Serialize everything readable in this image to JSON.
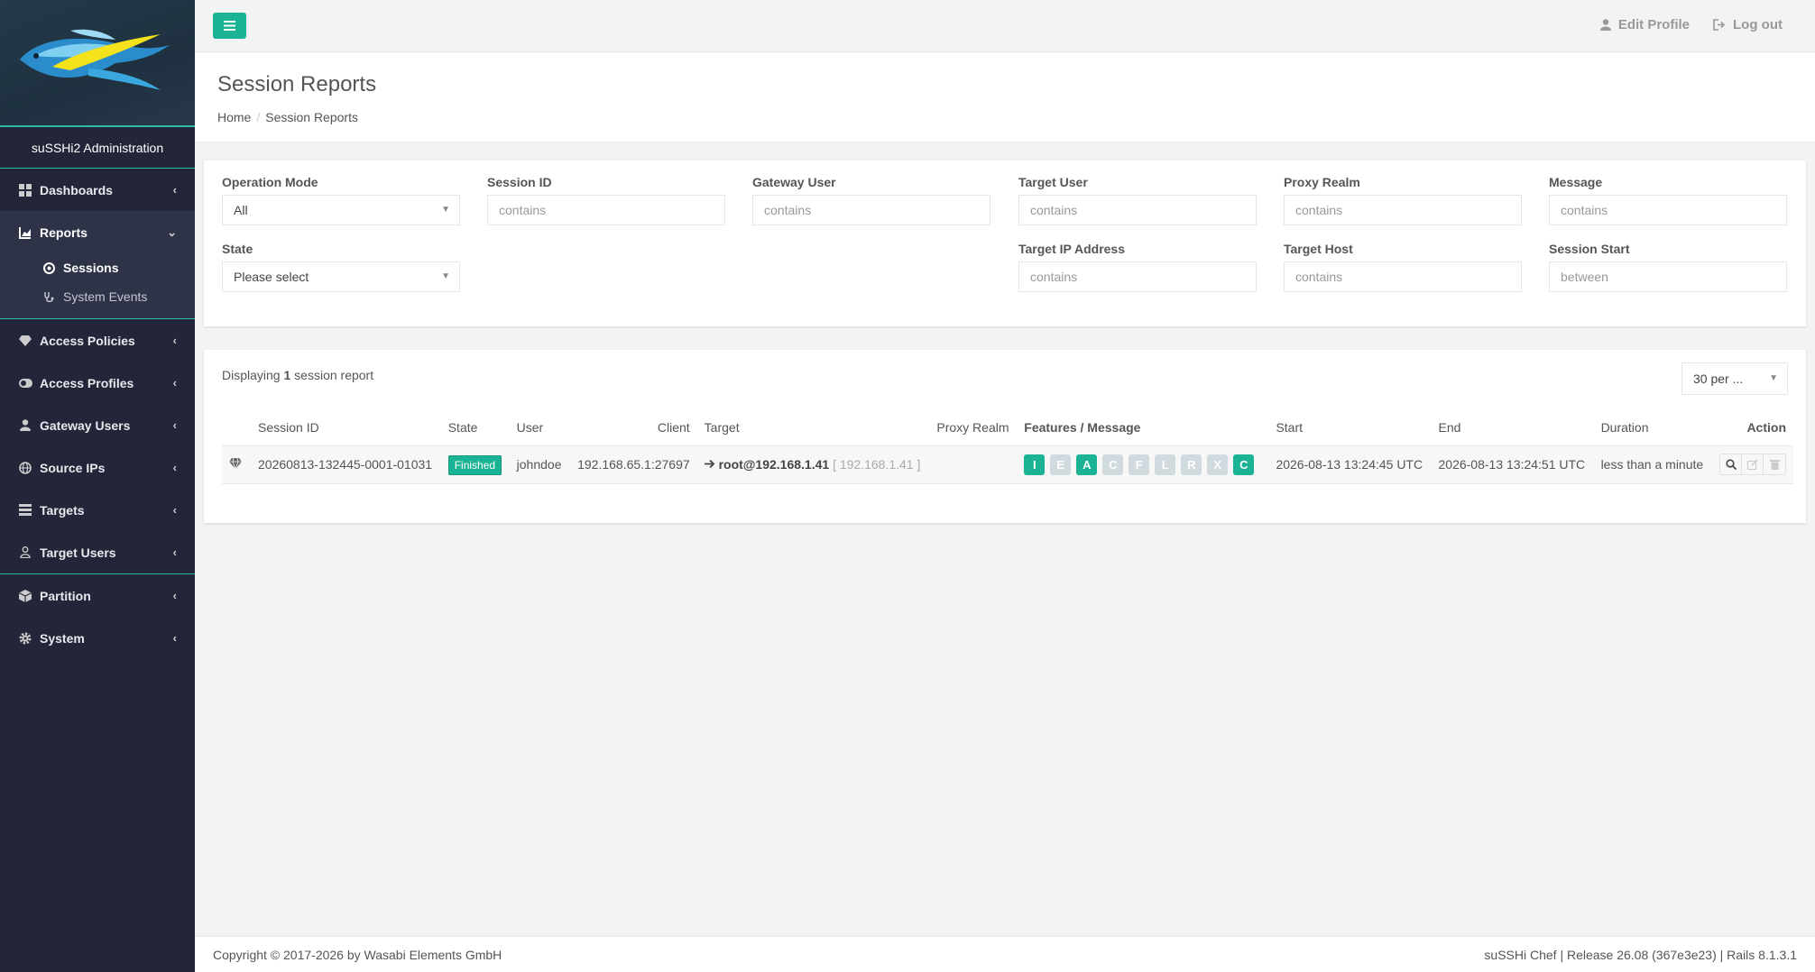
{
  "app": {
    "name": "suSSHi2 Administration"
  },
  "sidebar": {
    "items": [
      {
        "label": "Dashboards",
        "icon": "dashboard-icon"
      },
      {
        "label": "Reports",
        "icon": "chart-icon"
      },
      {
        "label": "Access Policies",
        "icon": "diamond-icon"
      },
      {
        "label": "Access Profiles",
        "icon": "toggle-icon"
      },
      {
        "label": "Gateway Users",
        "icon": "user-icon"
      },
      {
        "label": "Source IPs",
        "icon": "globe-icon"
      },
      {
        "label": "Targets",
        "icon": "server-icon"
      },
      {
        "label": "Target Users",
        "icon": "user-outline-icon"
      },
      {
        "label": "Partition",
        "icon": "cube-icon"
      },
      {
        "label": "System",
        "icon": "gear-icon"
      }
    ],
    "reports_sub": [
      {
        "label": "Sessions",
        "icon": "target-icon"
      },
      {
        "label": "System Events",
        "icon": "stethoscope-icon"
      }
    ]
  },
  "topbar": {
    "edit_profile": "Edit Profile",
    "logout": "Log out"
  },
  "heading": {
    "title": "Session Reports",
    "breadcrumb_home": "Home",
    "breadcrumb_current": "Session Reports"
  },
  "filters": {
    "operation_mode": {
      "label": "Operation Mode",
      "value": "All"
    },
    "session_id": {
      "label": "Session ID",
      "placeholder": "contains"
    },
    "gateway_user": {
      "label": "Gateway User",
      "placeholder": "contains"
    },
    "target_user": {
      "label": "Target User",
      "placeholder": "contains"
    },
    "proxy_realm": {
      "label": "Proxy Realm",
      "placeholder": "contains"
    },
    "message": {
      "label": "Message",
      "placeholder": "contains"
    },
    "state": {
      "label": "State",
      "value": "Please select"
    },
    "target_ip": {
      "label": "Target IP Address",
      "placeholder": "contains"
    },
    "target_host": {
      "label": "Target Host",
      "placeholder": "contains"
    },
    "session_start": {
      "label": "Session Start",
      "placeholder": "between"
    }
  },
  "results": {
    "summary_prefix": "Displaying",
    "count": "1",
    "summary_suffix": "session report",
    "per_page": "30 per ...",
    "columns": [
      "Session ID",
      "State",
      "User",
      "Client",
      "Target",
      "Proxy Realm",
      "Features / Message",
      "Start",
      "End",
      "Duration",
      "Action"
    ],
    "rows": [
      {
        "session_id": "20260813-132445-0001-01031",
        "state": "Finished",
        "user": "johndoe",
        "client": "192.168.65.1:27697",
        "target_host": "root@192.168.1.41",
        "target_ip": "[ 192.168.1.41 ]",
        "proxy_realm": "",
        "features": [
          {
            "letter": "I",
            "on": true
          },
          {
            "letter": "E",
            "on": false
          },
          {
            "letter": "A",
            "on": true
          },
          {
            "letter": "C",
            "on": false
          },
          {
            "letter": "F",
            "on": false
          },
          {
            "letter": "L",
            "on": false
          },
          {
            "letter": "R",
            "on": false
          },
          {
            "letter": "X",
            "on": false
          },
          {
            "letter": "C",
            "on": true
          }
        ],
        "start": "2026-08-13 13:24:45 UTC",
        "end": "2026-08-13 13:24:51 UTC",
        "duration": "less than a minute"
      }
    ]
  },
  "footer": {
    "copyright": "Copyright © 2017-2026 by Wasabi Elements GmbH",
    "release": "suSSHi Chef | Release 26.08 (367e3e23) | Rails 8.1.3.1"
  },
  "colors": {
    "accent": "#1ab394",
    "sidebar": "#232638",
    "teal_line": "#2fb9a8"
  }
}
